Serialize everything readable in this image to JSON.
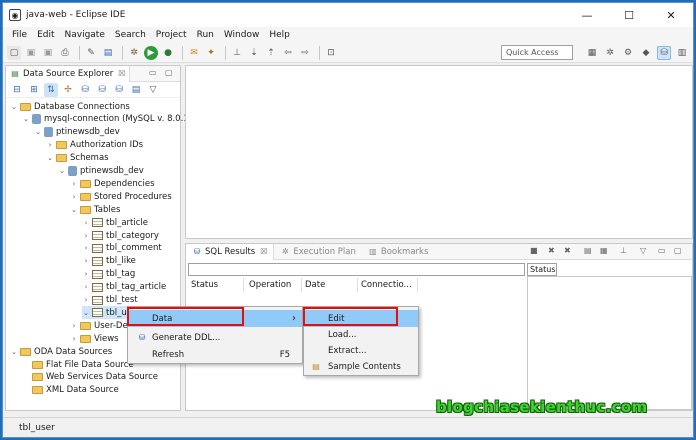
{
  "window": {
    "title": "java-web - Eclipse IDE",
    "controls": {
      "minimize": "—",
      "maximize": "☐",
      "close": "✕"
    }
  },
  "menubar": [
    "File",
    "Edit",
    "Navigate",
    "Search",
    "Project",
    "Run",
    "Window",
    "Help"
  ],
  "toolbar": {
    "quick_access": "Quick Access"
  },
  "explorer": {
    "tab_label": "Data Source Explorer",
    "tab_close": "☒",
    "tree": [
      {
        "label": "Database Connections",
        "indent": 0,
        "chev": "v",
        "icon": "folder-icon"
      },
      {
        "label": "mysql-connection (MySQL v. 8.0.1!",
        "indent": 1,
        "chev": "v",
        "icon": "connection-icon"
      },
      {
        "label": "ptinewsdb_dev",
        "indent": 2,
        "chev": "v",
        "icon": "database-icon"
      },
      {
        "label": "Authorization IDs",
        "indent": 3,
        "chev": ">",
        "icon": "folder-icon"
      },
      {
        "label": "Schemas",
        "indent": 3,
        "chev": "v",
        "icon": "folder-icon"
      },
      {
        "label": "ptinewsdb_dev",
        "indent": 4,
        "chev": "v",
        "icon": "schema-icon"
      },
      {
        "label": "Dependencies",
        "indent": 5,
        "chev": ">",
        "icon": "folder-icon"
      },
      {
        "label": "Stored Procedures",
        "indent": 5,
        "chev": ">",
        "icon": "folder-icon"
      },
      {
        "label": "Tables",
        "indent": 5,
        "chev": "v",
        "icon": "folder-icon"
      },
      {
        "label": "tbl_article",
        "indent": 6,
        "chev": ">",
        "icon": "table-icon"
      },
      {
        "label": "tbl_category",
        "indent": 6,
        "chev": ">",
        "icon": "table-icon"
      },
      {
        "label": "tbl_comment",
        "indent": 6,
        "chev": ">",
        "icon": "table-icon"
      },
      {
        "label": "tbl_like",
        "indent": 6,
        "chev": ">",
        "icon": "table-icon"
      },
      {
        "label": "tbl_tag",
        "indent": 6,
        "chev": ">",
        "icon": "table-icon"
      },
      {
        "label": "tbl_tag_article",
        "indent": 6,
        "chev": ">",
        "icon": "table-icon"
      },
      {
        "label": "tbl_test",
        "indent": 6,
        "chev": ">",
        "icon": "table-icon"
      },
      {
        "label": "tbl_user",
        "indent": 6,
        "chev": "v",
        "icon": "table-icon"
      },
      {
        "label": "User-Defi",
        "indent": 5,
        "chev": ">",
        "icon": "folder-icon"
      },
      {
        "label": "Views",
        "indent": 5,
        "chev": ">",
        "icon": "folder-icon"
      },
      {
        "label": "ODA Data Sources",
        "indent": 0,
        "chev": "v",
        "icon": "folder-icon"
      },
      {
        "label": "Flat File Data Source",
        "indent": 1,
        "chev": "",
        "icon": "folder-icon"
      },
      {
        "label": "Web Services Data Source",
        "indent": 1,
        "chev": "",
        "icon": "folder-icon"
      },
      {
        "label": "XML Data Source",
        "indent": 1,
        "chev": "",
        "icon": "folder-icon"
      }
    ]
  },
  "results_panel": {
    "tabs": [
      {
        "label": "SQL Results",
        "active": true
      },
      {
        "label": "Execution Plan",
        "active": false
      },
      {
        "label": "Bookmarks",
        "active": false
      }
    ],
    "columns": [
      "Status",
      "Operation",
      "Date",
      "Connectio..."
    ],
    "status_tab": "Status"
  },
  "context_menu": {
    "items": [
      {
        "label": "Data",
        "shortcut": "",
        "submenu": "›",
        "highlighted": true
      },
      {
        "label": "Generate DDL...",
        "shortcut": "",
        "submenu": "",
        "highlighted": false
      },
      {
        "label": "Refresh",
        "shortcut": "F5",
        "submenu": "",
        "highlighted": false
      }
    ]
  },
  "submenu": {
    "items": [
      {
        "label": "Edit",
        "highlighted": true
      },
      {
        "label": "Load...",
        "highlighted": false
      },
      {
        "label": "Extract...",
        "highlighted": false
      },
      {
        "label": "Sample Contents",
        "highlighted": false
      }
    ]
  },
  "status_bar": {
    "text": "tbl_user"
  },
  "watermark": "blogchiasekienthuc.com",
  "colors": {
    "highlight": "#91c9f7",
    "red_box": "#e01010",
    "watermark": "#38d82a"
  }
}
